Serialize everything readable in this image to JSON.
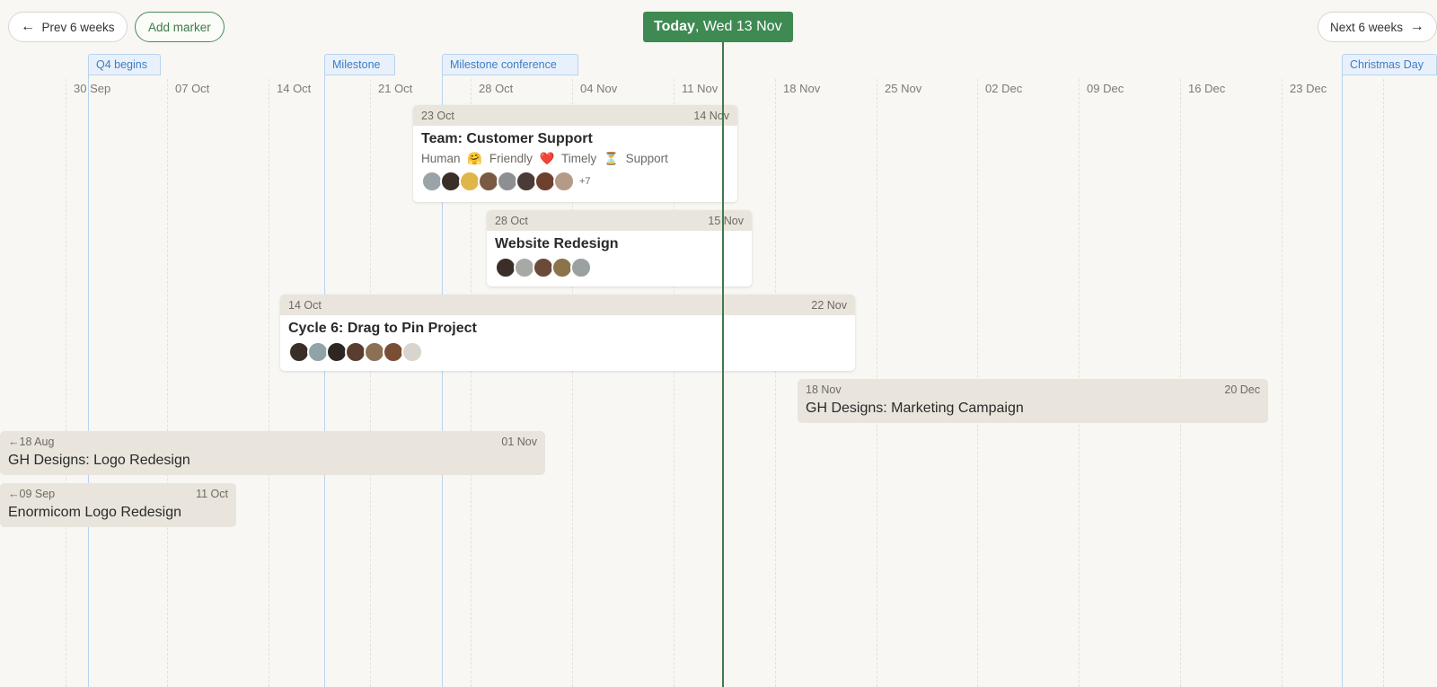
{
  "nav": {
    "prev_label": "Prev 6 weeks",
    "add_marker_label": "Add marker",
    "next_label": "Next 6 weeks",
    "today_bold": "Today",
    "today_rest": ", Wed 13 Nov"
  },
  "weeks": [
    "30 Sep",
    "07 Oct",
    "14 Oct",
    "21 Oct",
    "28 Oct",
    "04 Nov",
    "11 Nov",
    "18 Nov",
    "25 Nov",
    "02 Dec",
    "09 Dec",
    "16 Dec",
    "23 Dec"
  ],
  "markers": [
    {
      "label": "Q4 begins"
    },
    {
      "label": "Milestone"
    },
    {
      "label": "Milestone conference"
    },
    {
      "label": "Christmas Day"
    }
  ],
  "projects": [
    {
      "start": "23 Oct",
      "end": "14 Nov",
      "title": "Team: Customer Support",
      "tags": [
        "Human",
        "🤗",
        "Friendly",
        "❤️",
        "Timely",
        "⏳",
        "Support"
      ],
      "more": "+7"
    },
    {
      "start": "28 Oct",
      "end": "15 Nov",
      "title": "Website Redesign"
    },
    {
      "start": "14 Oct",
      "end": "22 Nov",
      "title": "Cycle 6: Drag to Pin Project"
    },
    {
      "start": "18 Nov",
      "end": "20 Dec",
      "title": "GH Designs: Marketing Campaign"
    },
    {
      "start": "←18 Aug",
      "end": "01 Nov",
      "title": "GH Designs: Logo Redesign"
    },
    {
      "start": "←09 Sep",
      "end": "11 Oct",
      "title": "Enormicom Logo Redesign"
    }
  ],
  "colors": {
    "accent": "#3f8a52",
    "marker": "#3f7cc2",
    "bar": "#e9e5dd",
    "background": "#f8f7f3"
  }
}
